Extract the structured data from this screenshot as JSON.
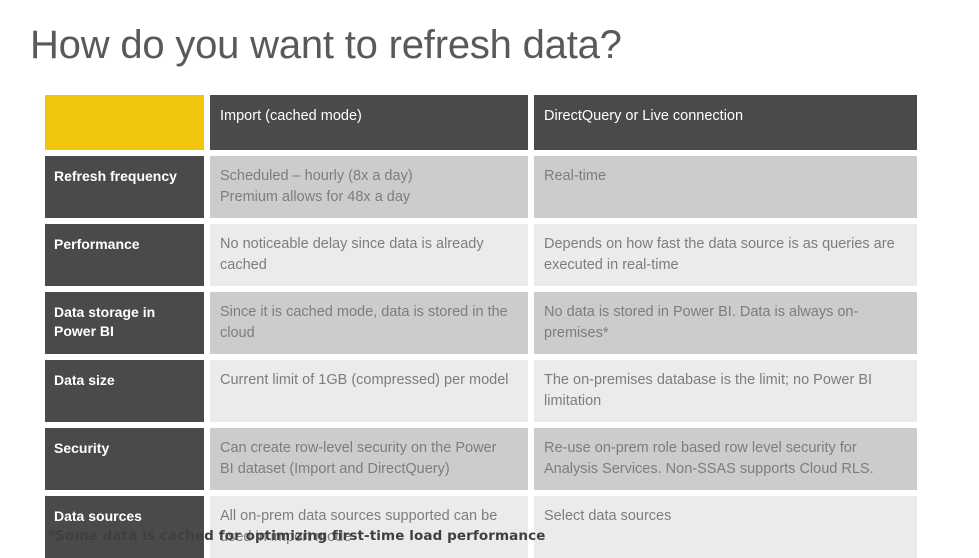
{
  "slide": {
    "title": "How do you want to refresh data?",
    "footnote": "*Some data is cached for optimizing first-time load performance"
  },
  "colors": {
    "accent_yellow": "#F2C60D",
    "header_dark": "#4A4A4A",
    "row_shade_dark": "#CCCCCC",
    "row_shade_light": "#EBEBEB",
    "title_gray": "#595959",
    "body_text_gray": "#7D7D7D"
  },
  "table": {
    "headers": {
      "corner": "",
      "import": "Import (cached mode)",
      "directquery": "DirectQuery or Live connection"
    },
    "rows": [
      {
        "label": "Refresh frequency",
        "import": "Scheduled – hourly (8x a day)\nPremium allows for 48x a day",
        "directquery": "Real-time"
      },
      {
        "label": "Performance",
        "import": "No noticeable delay since data is already cached",
        "directquery": "Depends on how fast the data source is as queries are executed in real-time"
      },
      {
        "label": "Data storage in Power BI",
        "import": "Since it is cached mode, data is stored in the cloud",
        "directquery": "No data is stored in Power BI. Data is always on-premises*"
      },
      {
        "label": "Data size",
        "import": "Current limit of 1GB (compressed) per model",
        "directquery": "The on-premises database is the limit; no Power BI limitation"
      },
      {
        "label": "Security",
        "import": "Can create row-level security on the Power BI dataset (Import and DirectQuery)",
        "directquery": "Re-use on-prem role based row level security for Analysis Services. Non-SSAS supports Cloud RLS."
      },
      {
        "label": "Data sources",
        "import": "All on-prem data sources supported can be used in import mode",
        "directquery": "Select data sources"
      }
    ]
  }
}
